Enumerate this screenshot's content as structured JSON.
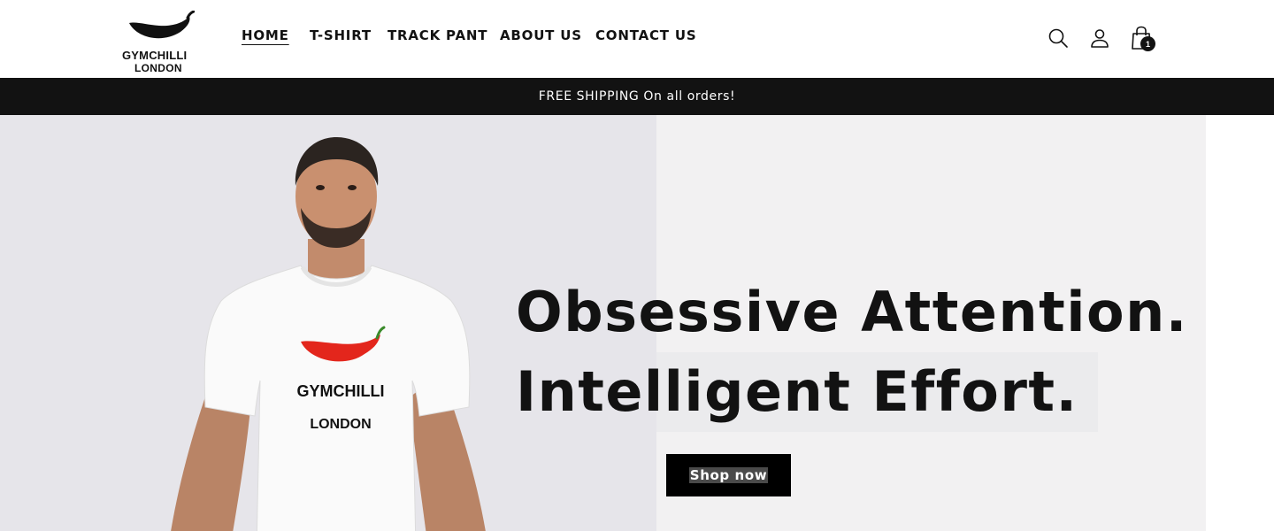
{
  "brand": {
    "logo_line1": "GYMCHILLI",
    "logo_line2": "LONDON"
  },
  "nav": {
    "items": [
      {
        "label": "HOME",
        "active": true
      },
      {
        "label": "T-SHIRT",
        "active": false
      },
      {
        "label": "TRACK PANT",
        "active": false
      },
      {
        "label": "ABOUT US",
        "active": false
      },
      {
        "label": "CONTACT US",
        "active": false
      }
    ]
  },
  "header_icons": {
    "search": "search-icon",
    "account": "user-icon",
    "cart": "shopping-bag-icon",
    "cart_count": "1"
  },
  "announcement": {
    "text": "FREE SHIPPING On all orders!"
  },
  "hero": {
    "heading_line1": "Obsessive Attention.",
    "heading_line2": "Intelligent Effort.",
    "button_label": "Shop now",
    "tshirt_text_line1": "GYMCHILLI",
    "tshirt_text_line2": "LONDON"
  },
  "colors": {
    "announcement_bg": "#121212",
    "hero_left_bg": "#e6e5ea",
    "hero_right_bg": "#f2f1f2",
    "button_bg": "#000000",
    "chilli_red": "#e3261c",
    "chilli_stem": "#3a8a2a"
  }
}
